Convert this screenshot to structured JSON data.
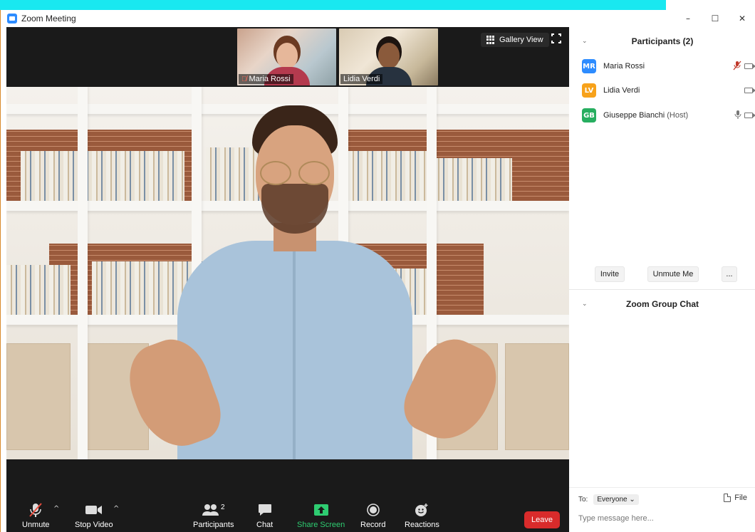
{
  "window": {
    "title": "Zoom Meeting",
    "minimize_glyph": "–",
    "maximize_glyph": "☐",
    "close_glyph": "✕"
  },
  "thumbnails": [
    {
      "name": "Maria Rossi",
      "muted": true
    },
    {
      "name": "Lidia Verdi",
      "muted": false
    }
  ],
  "view": {
    "gallery_label": "Gallery View"
  },
  "toolbar": {
    "unmute": "Unmute",
    "stop_video": "Stop Video",
    "participants": "Participants",
    "participants_count": "2",
    "chat": "Chat",
    "share_screen": "Share Screen",
    "record": "Record",
    "reactions": "Reactions",
    "leave": "Leave",
    "caret_glyph": "^"
  },
  "participants_panel": {
    "title": "Participants (2)",
    "list": [
      {
        "initials": "MR",
        "name": "Maria Rossi",
        "role": "",
        "color": "#2d8cff",
        "mic": "muted"
      },
      {
        "initials": "LV",
        "name": "Lidia Verdi",
        "role": "",
        "color": "#f7a21b",
        "mic": "none"
      },
      {
        "initials": "GB",
        "name": "Giuseppe Bianchi",
        "role": "(Host)",
        "color": "#27ae60",
        "mic": "on"
      }
    ],
    "invite": "Invite",
    "unmute_me": "Unmute Me",
    "more": "..."
  },
  "chat_panel": {
    "title": "Zoom Group Chat",
    "to_label": "To:",
    "to_value": "Everyone",
    "file_label": "File",
    "placeholder": "Type message here..."
  },
  "colors": {
    "accent": "#2d8cff",
    "share_green": "#2ecc71",
    "leave_red": "#d92b2b",
    "banner_cyan": "#19e8f0"
  }
}
